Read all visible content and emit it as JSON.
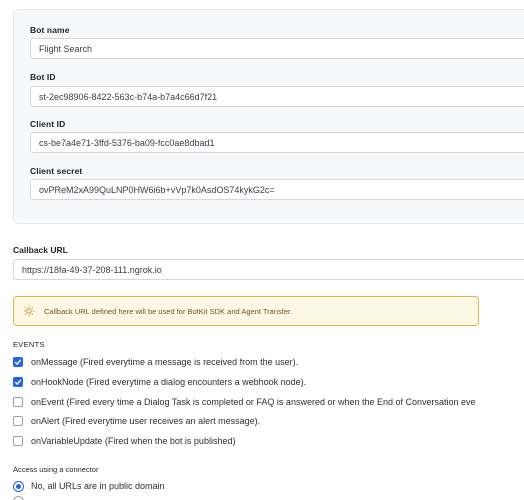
{
  "bot_card": {
    "bot_name_label": "Bot name",
    "bot_name_value": "Flight Search",
    "bot_id_label": "Bot ID",
    "bot_id_value": "st-2ec98906-8422-563c-b74a-b7a4c66d7f21",
    "client_id_label": "Client ID",
    "client_id_value": "cs-be7a4e71-3ffd-5376-ba09-fcc0ae8dbad1",
    "client_secret_label": "Client secret",
    "client_secret_value": "ovPReM2xA99QuLNP0HW6i6b+vVp7k0AsdOS74kykG2c="
  },
  "callback": {
    "label": "Callback URL",
    "value": "https://18fa-49-37-208-111.ngrok.io",
    "note": "Callback URL defined here will be used for BotKit SDK and Agent Transfer.",
    "note_icon": "lightbulb-icon"
  },
  "events": {
    "heading": "EVENTS",
    "items": [
      {
        "label": "onMessage (Fired everytime a message is received from the user).",
        "checked": true
      },
      {
        "label": "onHookNode (Fired everytime a dialog encounters a webhook node).",
        "checked": true
      },
      {
        "label": "onEvent (Fired every time a Dialog Task is completed or FAQ is answered or when the End of Conversation eve",
        "checked": false
      },
      {
        "label": "onAlert (Fired everytime user receives an alert message).",
        "checked": false
      },
      {
        "label": "onVariableUpdate (Fired when the bot is published)",
        "checked": false
      }
    ]
  },
  "access": {
    "heading": "Access using a connector",
    "selected_option": "No, all URLs are in public domain"
  },
  "colors": {
    "accent": "#2563eb",
    "note_border": "#d9b64a",
    "note_bg": "#fdf8e6"
  }
}
